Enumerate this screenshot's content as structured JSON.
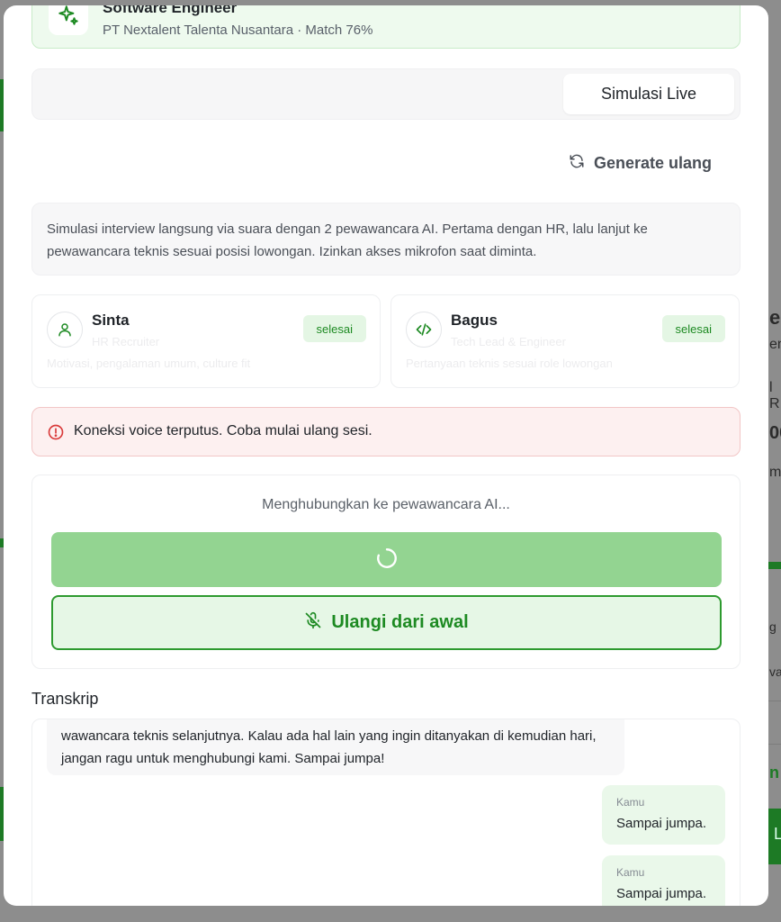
{
  "background": {
    "fragments": [
      "e",
      "en",
      "l R",
      "00",
      "m",
      "g",
      "va",
      "n",
      "L"
    ]
  },
  "job": {
    "title": "Software Engineer",
    "subtitle": "PT Nextalent Talenta Nusantara · Match 76%",
    "icon": "sparkle-icon"
  },
  "tabs": {
    "live_label": "Simulasi Live"
  },
  "regenerate": {
    "label": "Generate ulang",
    "icon": "refresh-icon"
  },
  "info": {
    "text": "Simulasi interview langsung via suara dengan 2 pewawancara AI. Pertama dengan HR, lalu lanjut ke pewawancara teknis sesuai posisi lowongan. Izinkan akses mikrofon saat diminta."
  },
  "interviewers": [
    {
      "name": "Sinta",
      "role": "HR Recruiter",
      "desc": "Motivasi, pengalaman umum, culture fit",
      "status": "selesai",
      "icon": "user-icon"
    },
    {
      "name": "Bagus",
      "role": "Tech Lead & Engineer",
      "desc": "Pertanyaan teknis sesuai role lowongan",
      "status": "selesai",
      "icon": "code-icon"
    }
  ],
  "alert": {
    "text": "Koneksi voice terputus. Coba mulai ulang sesi.",
    "icon": "alert-circle-icon"
  },
  "call": {
    "status": "Menghubungkan ke pewawancara AI...",
    "restart_label": "Ulangi dari awal",
    "restart_icon": "mic-off-icon"
  },
  "transcript": {
    "title": "Transkrip",
    "ai_message": "wawancara teknis selanjutnya. Kalau ada hal lain yang ingin ditanyakan di kemudian hari, jangan ragu untuk menghubungi kami. Sampai jumpa!",
    "user_messages": [
      {
        "who": "Kamu",
        "text": "Sampai jumpa."
      },
      {
        "who": "Kamu",
        "text": "Sampai jumpa."
      }
    ]
  },
  "colors": {
    "accent": "#1d8a22",
    "accent_light": "#93d491",
    "alert_bg": "#fdf0f0",
    "alert_red": "#d93a3a"
  }
}
